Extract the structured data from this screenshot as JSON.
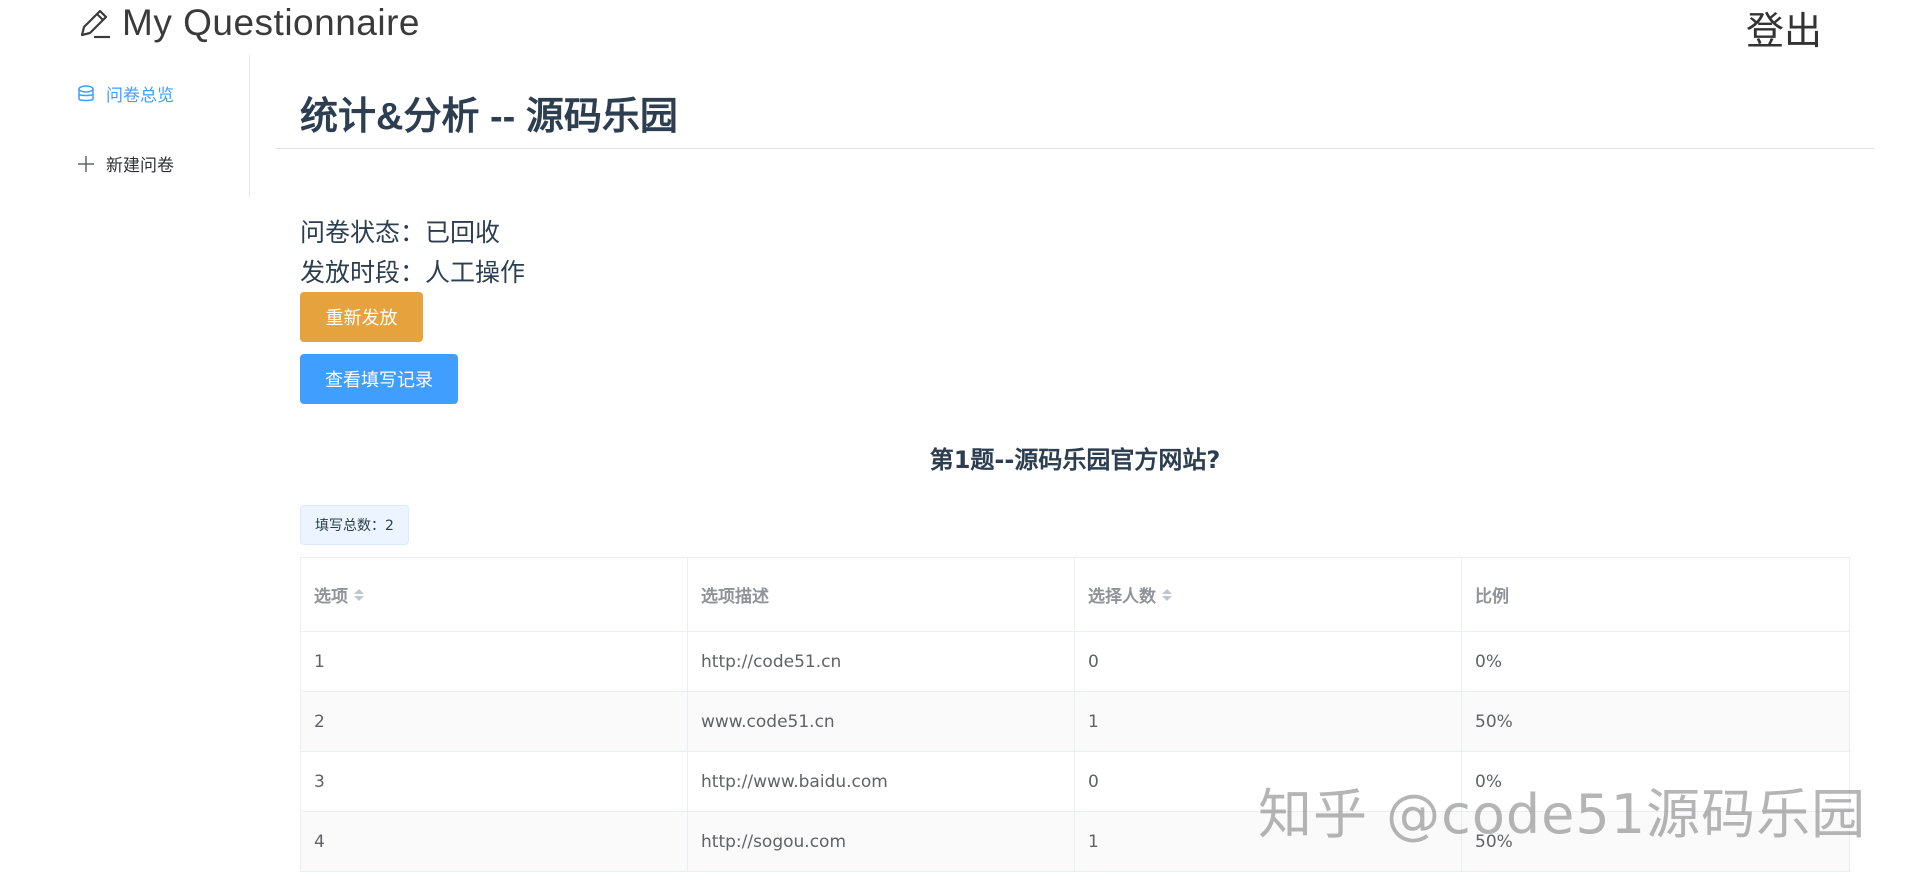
{
  "header": {
    "app_title": "My Questionnaire",
    "logout_label": "登出"
  },
  "sidebar": {
    "items": [
      {
        "label": "问卷总览",
        "icon": "database-icon",
        "active": true
      },
      {
        "label": "新建问卷",
        "icon": "plus-icon",
        "active": false
      }
    ]
  },
  "main": {
    "title": "统计&分析 -- 源码乐园",
    "status_line": "问卷状态：已回收",
    "period_line": "发放时段：人工操作",
    "republish_label": "重新发放",
    "view_records_label": "查看填写记录",
    "question_title": "第1题--源码乐园官方网站?",
    "count_tag": "填写总数：2"
  },
  "table": {
    "columns": [
      "选项",
      "选项描述",
      "选择人数",
      "比例"
    ],
    "rows": [
      [
        "1",
        "http://code51.cn",
        "0",
        "0%"
      ],
      [
        "2",
        "www.code51.cn",
        "1",
        "50%"
      ],
      [
        "3",
        "http://www.baidu.com",
        "0",
        "0%"
      ],
      [
        "4",
        "http://sogou.com",
        "1",
        "50%"
      ]
    ]
  },
  "watermark": "知乎 @code51源码乐园",
  "colors": {
    "primary": "#409eff",
    "warning": "#e6a23c",
    "title": "#2c3e50"
  }
}
